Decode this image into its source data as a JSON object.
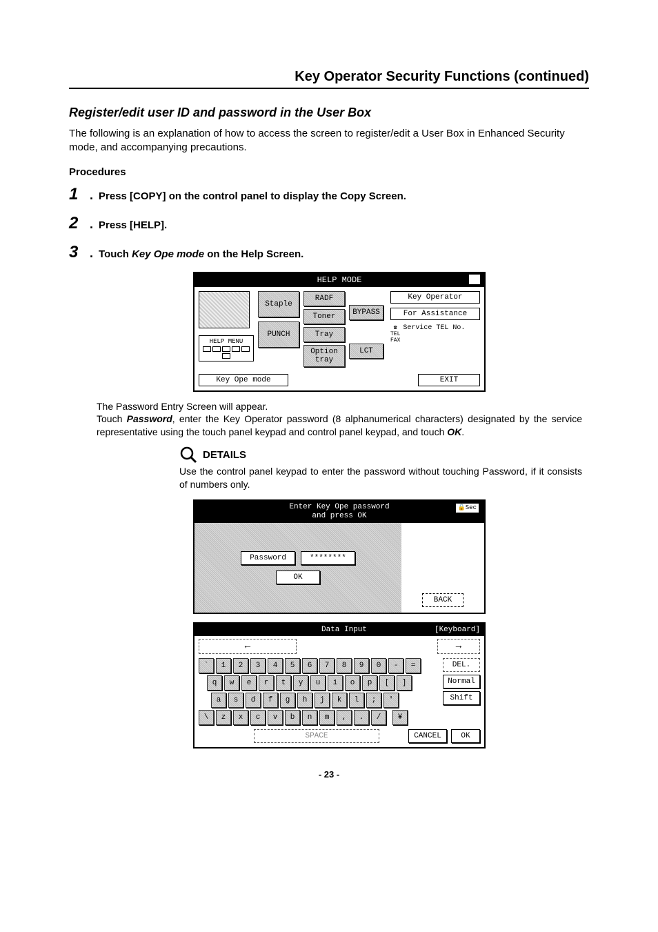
{
  "header": {
    "title": "Key Operator Security Functions (continued)"
  },
  "section": {
    "title": "Register/edit user ID and password in the User Box",
    "intro": "The following is an explanation of how to access the screen to register/edit a User Box in Enhanced Security mode, and accompanying precautions.",
    "procedures_label": "Procedures"
  },
  "steps": {
    "s1": {
      "num": "1",
      "text": "Press [COPY] on the control panel to display the Copy Screen."
    },
    "s2": {
      "num": "2",
      "text": "Press [HELP]."
    },
    "s3": {
      "num": "3",
      "pre": "Touch ",
      "ital": "Key Ope mode",
      "post": " on the Help Screen."
    }
  },
  "para1": {
    "l1": "The Password Entry Screen will appear.",
    "l2a": "Touch ",
    "l2b": "Password",
    "l2c": ", enter the Key Operator password (8 alphanumerical characters) designated by the service representative using the touch panel keypad and control panel keypad, and touch ",
    "l2d": "OK",
    "l2e": "."
  },
  "details": {
    "label": "DETAILS",
    "text": "Use the control panel keypad to enter the password without touching Password, if it consists of numbers only."
  },
  "screen1": {
    "title": "HELP MODE",
    "help_menu": "HELP MENU",
    "staple": "Staple",
    "punch": "PUNCH",
    "radf": "RADF",
    "toner": "Toner",
    "tray": "Tray",
    "option_tray": "Option tray",
    "bypass": "BYPASS",
    "lct": "LCT",
    "key_operator": "Key Operator",
    "assistance": "For Assistance",
    "service_tel": "Service TEL No.",
    "tel": "TEL",
    "fax": "FAX",
    "key_ope_mode": "Key Ope mode",
    "exit": "EXIT"
  },
  "screen2": {
    "title_l1": "Enter Key Ope password",
    "title_l2": "and press OK",
    "sec": "🔒Sec",
    "password": "Password",
    "masked": "********",
    "ok": "OK",
    "back": "BACK"
  },
  "screen3": {
    "title": "Data Input",
    "mode": "[Keyboard]",
    "arrow_left": "←",
    "arrow_right": "→",
    "row1": [
      "`",
      "1",
      "2",
      "3",
      "4",
      "5",
      "6",
      "7",
      "8",
      "9",
      "0",
      "-",
      "="
    ],
    "row2": [
      "q",
      "w",
      "e",
      "r",
      "t",
      "y",
      "u",
      "i",
      "o",
      "p",
      "[",
      "]"
    ],
    "row3": [
      "a",
      "s",
      "d",
      "f",
      "g",
      "h",
      "j",
      "k",
      "l",
      ";",
      "'"
    ],
    "row4": [
      "\\",
      "z",
      "x",
      "c",
      "v",
      "b",
      "n",
      "m",
      ",",
      ".",
      "/"
    ],
    "del": "DEL.",
    "normal": "Normal",
    "shift": "Shift",
    "space": "SPACE",
    "cancel": "CANCEL",
    "ok": "OK",
    "yen": "¥"
  },
  "page_number": "- 23 -"
}
